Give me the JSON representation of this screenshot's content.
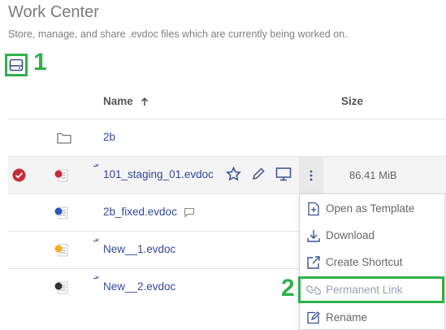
{
  "header": {
    "title": "Work Center",
    "subtitle": "Store, manage, and share .evdoc files which are currently being worked on."
  },
  "annotations": {
    "step1": "1",
    "step2": "2",
    "color": "#2fb24c"
  },
  "table": {
    "columns": {
      "name": "Name",
      "size": "Size"
    },
    "rows": [
      {
        "name": "2b",
        "type": "folder"
      },
      {
        "name": "101_staging_01.evdoc",
        "size": "86.41 MiB",
        "selected": true
      },
      {
        "name": "2b_fixed.evdoc"
      },
      {
        "name": "New__1.evdoc"
      },
      {
        "name": "New__2.evdoc"
      }
    ]
  },
  "context_menu": {
    "items": [
      {
        "label": "Open as Template",
        "icon": "template-icon"
      },
      {
        "label": "Download",
        "icon": "download-icon"
      },
      {
        "label": "Create Shortcut",
        "icon": "shortcut-icon"
      },
      {
        "label": "Permanent Link",
        "icon": "link-icon"
      },
      {
        "label": "Rename",
        "icon": "rename-icon"
      }
    ]
  },
  "colors": {
    "link": "#33479b",
    "accent_red": "#c62c38",
    "doc_blue": "#2e55b8",
    "doc_yellow": "#f2b01e"
  }
}
